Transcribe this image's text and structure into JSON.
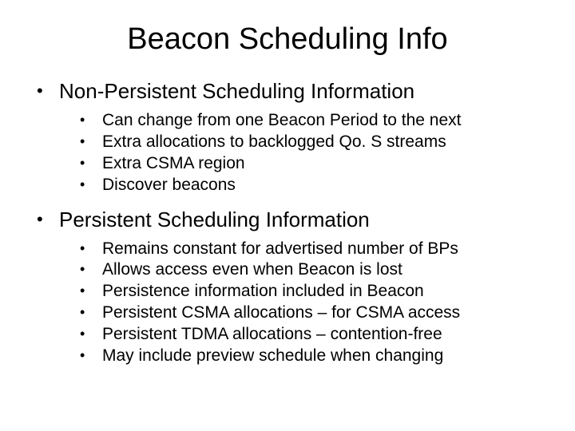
{
  "title": "Beacon Scheduling Info",
  "sections": [
    {
      "heading": "Non-Persistent Scheduling Information",
      "items": [
        "Can change from one Beacon Period to the next",
        "Extra allocations to backlogged Qo. S streams",
        "Extra CSMA region",
        "Discover beacons"
      ]
    },
    {
      "heading": "Persistent Scheduling Information",
      "items": [
        "Remains constant for advertised number of BPs",
        "Allows access even when Beacon is lost",
        "Persistence information included in Beacon",
        "Persistent CSMA allocations – for CSMA access",
        "Persistent TDMA allocations – contention-free",
        "May include preview schedule when changing"
      ]
    }
  ]
}
